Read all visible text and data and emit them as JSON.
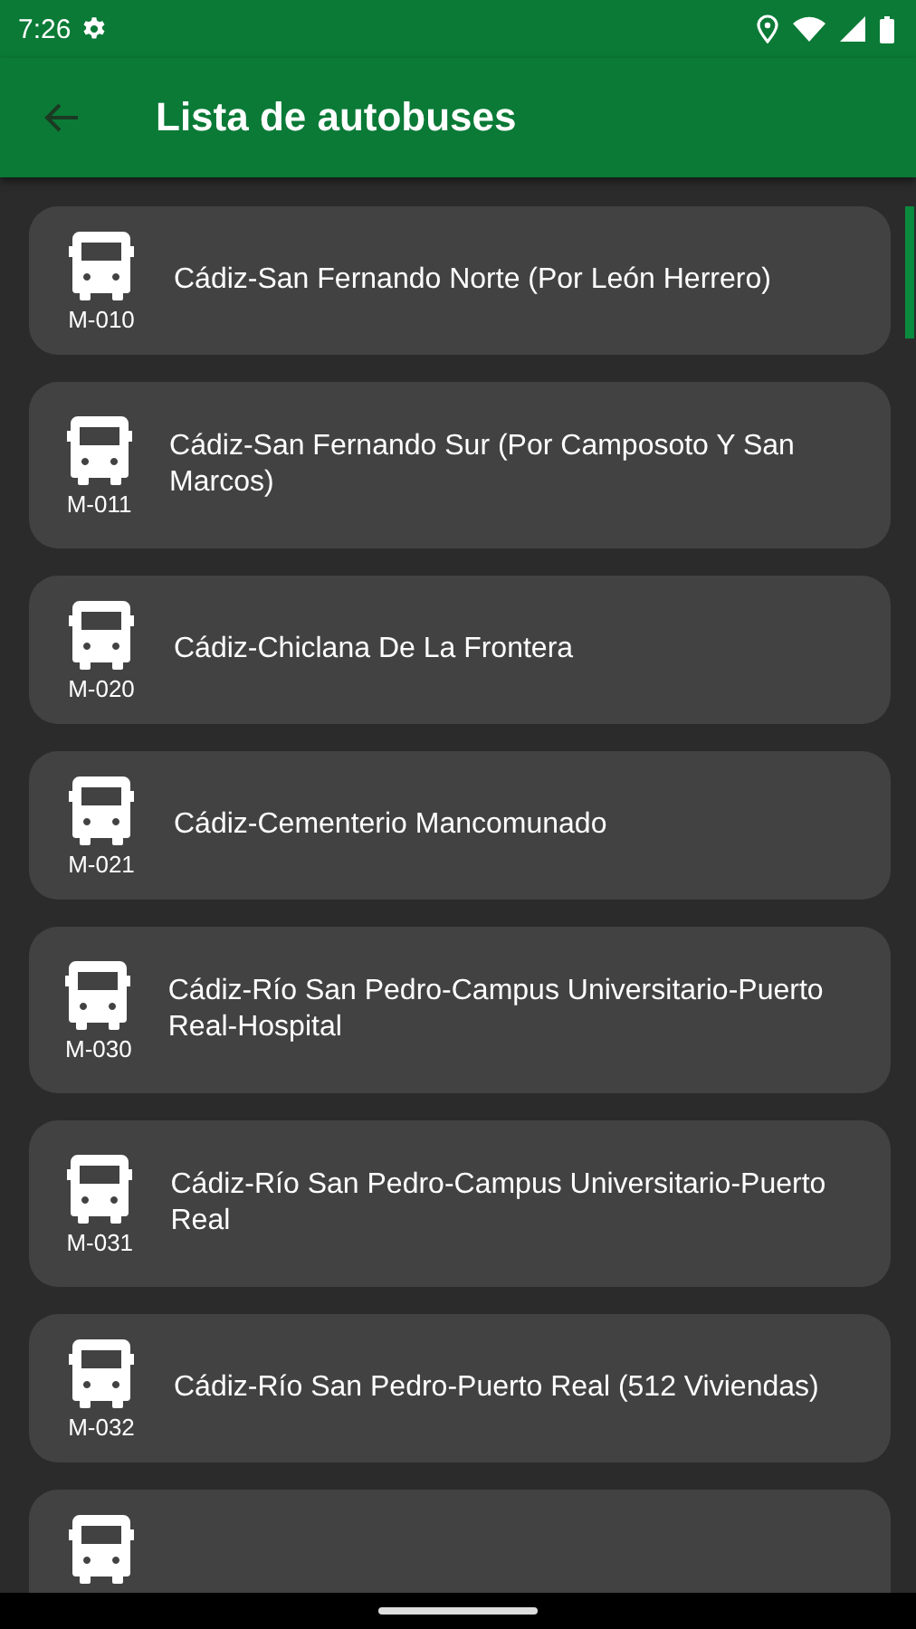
{
  "status_bar": {
    "time": "7:26"
  },
  "app_bar": {
    "title": "Lista de autobuses"
  },
  "routes": [
    {
      "kind": "route",
      "code": "M-010",
      "name": "Cádiz-San Fernando Norte (Por León Herrero)"
    },
    {
      "kind": "route",
      "code": "M-011",
      "name": "Cádiz-San Fernando Sur (Por Camposoto Y San Marcos)"
    },
    {
      "kind": "route",
      "code": "M-020",
      "name": "Cádiz-Chiclana De La Frontera"
    },
    {
      "kind": "route",
      "code": "M-021",
      "name": "Cádiz-Cementerio Mancomunado"
    },
    {
      "kind": "route",
      "code": "M-030",
      "name": "Cádiz-Río San Pedro-Campus Universitario-Puerto Real-Hospital"
    },
    {
      "kind": "route",
      "code": "M-031",
      "name": "Cádiz-Río San Pedro-Campus Universitario-Puerto Real"
    },
    {
      "kind": "route",
      "code": "M-032",
      "name": "Cádiz-Río San Pedro-Puerto Real (512 Viviendas)"
    },
    {
      "kind": "cut"
    }
  ]
}
